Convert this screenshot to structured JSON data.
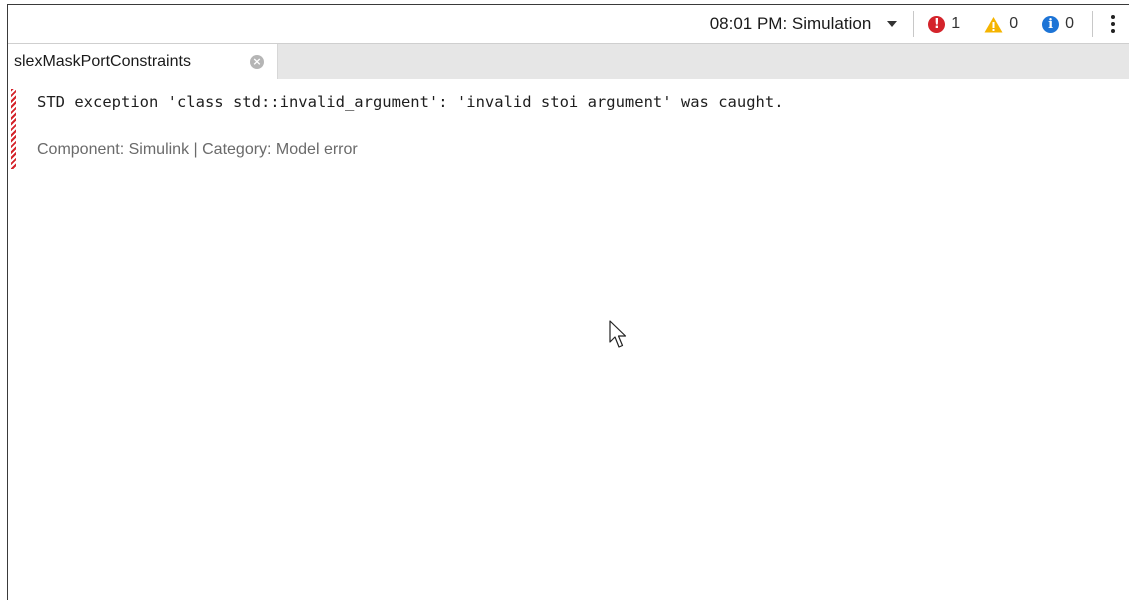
{
  "toolbar": {
    "run_label": "08:01 PM: Simulation",
    "errors_count": "1",
    "warnings_count": "0",
    "info_count": "0",
    "colors": {
      "error": "#d4242b",
      "warning": "#f5b400",
      "info": "#1d74d6"
    }
  },
  "tabs": [
    {
      "label": "slexMaskPortConstraints",
      "active": true
    }
  ],
  "diagnostic": {
    "message": "STD exception 'class std::invalid_argument': 'invalid stoi argument' was caught.",
    "details": "Component: Simulink | Category: Model error",
    "severity": "error"
  }
}
